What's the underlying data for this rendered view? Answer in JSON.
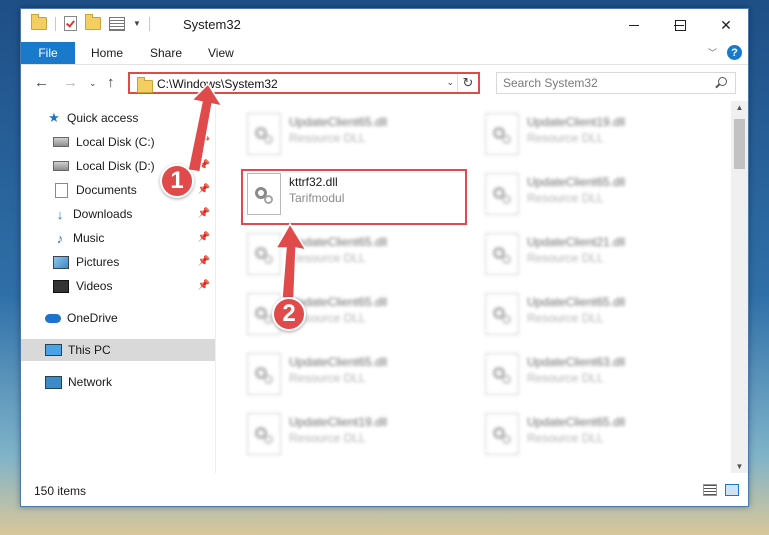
{
  "window": {
    "title": "System32",
    "controls": {
      "minimize": "",
      "maximize": "",
      "close": "✕"
    }
  },
  "ribbon": {
    "tabs": [
      "File",
      "Home",
      "Share",
      "View"
    ]
  },
  "nav": {
    "address": "C:\\Windows\\System32",
    "search_placeholder": "Search System32"
  },
  "sidebar": {
    "items": [
      {
        "label": "Quick access",
        "icon": "star-icon",
        "pinned": false
      },
      {
        "label": "Local Disk (C:)",
        "icon": "drive-icon",
        "pinned": true
      },
      {
        "label": "Local Disk (D:)",
        "icon": "drive-icon",
        "pinned": true
      },
      {
        "label": "Documents",
        "icon": "documents-icon",
        "pinned": true
      },
      {
        "label": "Downloads",
        "icon": "download-icon",
        "pinned": true
      },
      {
        "label": "Music",
        "icon": "music-icon",
        "pinned": true
      },
      {
        "label": "Pictures",
        "icon": "pictures-icon",
        "pinned": true
      },
      {
        "label": "Videos",
        "icon": "video-icon",
        "pinned": true
      },
      {
        "label": "OneDrive",
        "icon": "cloud-icon",
        "pinned": false
      },
      {
        "label": "This PC",
        "icon": "computer-icon",
        "pinned": false,
        "selected": true
      },
      {
        "label": "Network",
        "icon": "network-icon",
        "pinned": false
      }
    ]
  },
  "files": [
    {
      "name": "UpdateClient65.dll",
      "desc": "Resource DLL"
    },
    {
      "name": "UpdateClient19.dll",
      "desc": "Resource DLL"
    },
    {
      "name": "kttrf32.dll",
      "desc": "Tarifmodul"
    },
    {
      "name": "UpdateClient65.dll",
      "desc": "Resource DLL"
    },
    {
      "name": "UpdateClient65.dll",
      "desc": "Resource DLL"
    },
    {
      "name": "UpdateClient21.dll",
      "desc": "Resource DLL"
    },
    {
      "name": "UpdateClient65.dll",
      "desc": "Resource DLL"
    },
    {
      "name": "UpdateClient65.dll",
      "desc": "Resource DLL"
    },
    {
      "name": "UpdateClient65.dll",
      "desc": "Resource DLL"
    },
    {
      "name": "UpdateClient63.dll",
      "desc": "Resource DLL"
    },
    {
      "name": "UpdateClient19.dll",
      "desc": "Resource DLL"
    },
    {
      "name": "UpdateClient65.dll",
      "desc": "Resource DLL"
    }
  ],
  "status": {
    "item_count": "150 items"
  },
  "annotations": {
    "badge1": "1",
    "badge2": "2",
    "color": "#e04a4a"
  }
}
